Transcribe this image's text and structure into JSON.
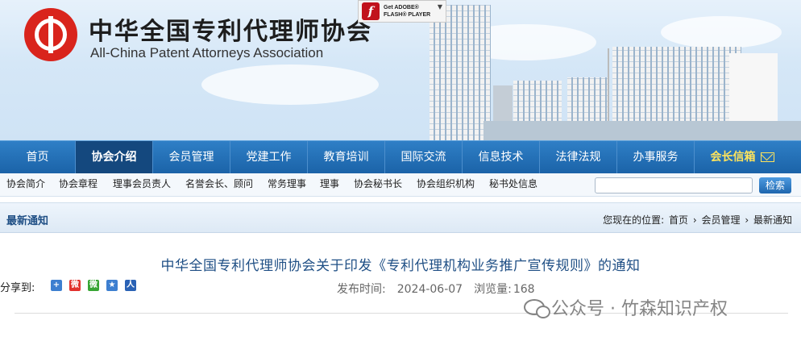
{
  "header": {
    "title_cn": "中华全国专利代理师协会",
    "title_en": "All-China Patent Attorneys Association",
    "flash_badge": {
      "line1": "Get ADOBE®",
      "line2": "FLASH® PLAYER",
      "icon": "flash-icon"
    }
  },
  "nav": {
    "items": [
      "首页",
      "协会介绍",
      "会员管理",
      "党建工作",
      "教育培训",
      "国际交流",
      "信息技术",
      "法律法规",
      "办事服务",
      "会长信箱"
    ],
    "active": "协会介绍"
  },
  "subnav": {
    "items": [
      "协会简介",
      "协会章程",
      "理事会员责人",
      "名誉会长、顾问",
      "常务理事",
      "理事",
      "协会秘书长",
      "协会组织机构",
      "秘书处信息"
    ]
  },
  "search": {
    "value": "",
    "button_label": "检索"
  },
  "section": {
    "title": "最新通知",
    "breadcrumb_prefix": "您现在的位置:",
    "breadcrumb": [
      "首页",
      "会员管理",
      "最新通知"
    ],
    "separator": "›"
  },
  "article": {
    "title": "中华全国专利代理师协会关于印发《专利代理机构业务推广宣传规则》的通知",
    "share_label": "分享到:",
    "share_icons": [
      {
        "name": "qzone-share-icon",
        "glyph": "+",
        "color": "#3d7fd0"
      },
      {
        "name": "weibo-share-icon",
        "glyph": "微",
        "color": "#e2312d"
      },
      {
        "name": "wechat-share-icon",
        "glyph": "微",
        "color": "#38a534"
      },
      {
        "name": "favorite-share-icon",
        "glyph": "★",
        "color": "#3d7fd0"
      },
      {
        "name": "renren-share-icon",
        "glyph": "人",
        "color": "#2a62b5"
      }
    ],
    "publish_label": "发布时间:",
    "publish_date": "2024-06-07",
    "views_label": "浏览量:",
    "views": "168"
  },
  "watermark": {
    "text": "公众号 · 竹森知识产权",
    "icon": "wechat-official-account-icon"
  }
}
